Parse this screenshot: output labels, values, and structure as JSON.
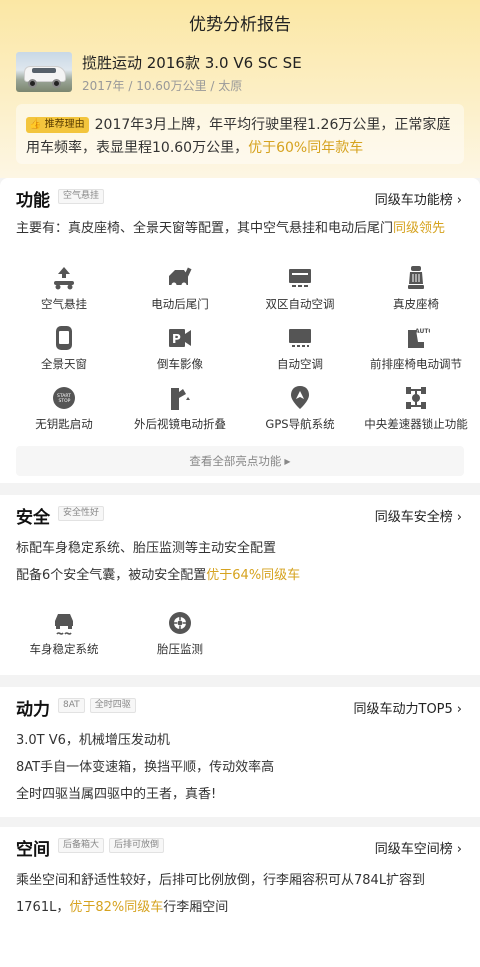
{
  "page": {
    "title": "优势分析报告"
  },
  "car": {
    "name": "揽胜运动 2016款 3.0 V6 SC SE",
    "meta": "2017年 / 10.60万公里 / 太原"
  },
  "reason": {
    "tag": "推荐理由",
    "text": "2017年3月上牌，年平均行驶里程1.26万公里，正常家庭用车频率，表显里程10.60万公里，",
    "highlight": "优于60%同年款车"
  },
  "function": {
    "title": "功能",
    "tags": [
      "空气悬挂"
    ],
    "link": "同级车功能榜",
    "desc_prefix": "主要有：真皮座椅、全景天窗等配置，其中空气悬挂和电动后尾门",
    "desc_highlight": "同级领先",
    "features": [
      {
        "label": "空气悬挂",
        "icon": "air-suspension-icon"
      },
      {
        "label": "电动后尾门",
        "icon": "power-tailgate-icon"
      },
      {
        "label": "双区自动空调",
        "icon": "dual-zone-ac-icon"
      },
      {
        "label": "真皮座椅",
        "icon": "leather-seat-icon"
      },
      {
        "label": "全景天窗",
        "icon": "panoramic-sunroof-icon"
      },
      {
        "label": "倒车影像",
        "icon": "reverse-camera-icon"
      },
      {
        "label": "自动空调",
        "icon": "auto-ac-icon"
      },
      {
        "label": "前排座椅电动调节",
        "icon": "power-seat-icon"
      },
      {
        "label": "无钥匙启动",
        "icon": "keyless-start-icon"
      },
      {
        "label": "外后视镜电动折叠",
        "icon": "mirror-fold-icon"
      },
      {
        "label": "GPS导航系统",
        "icon": "gps-icon"
      },
      {
        "label": "中央差速器锁止功能",
        "icon": "diff-lock-icon"
      }
    ],
    "view_all": "查看全部亮点功能"
  },
  "safety": {
    "title": "安全",
    "tags": [
      "安全性好"
    ],
    "link": "同级车安全榜",
    "line1": "标配车身稳定系统、胎压监测等主动安全配置",
    "line2_prefix": "配备6个安全气囊，被动安全配置",
    "line2_highlight": "优于64%同级车",
    "features": [
      {
        "label": "车身稳定系统",
        "icon": "esp-icon"
      },
      {
        "label": "胎压监测",
        "icon": "tire-pressure-icon"
      }
    ]
  },
  "power": {
    "title": "动力",
    "tags": [
      "8AT",
      "全时四驱"
    ],
    "link": "同级车动力TOP5",
    "lines": [
      "3.0T V6，机械增压发动机",
      "8AT手自一体变速箱，换挡平顺，传动效率高",
      "全时四驱当属四驱中的王者，真香!"
    ]
  },
  "space": {
    "title": "空间",
    "tags": [
      "后备箱大",
      "后排可放倒"
    ],
    "link": "同级车空间榜",
    "line1": "乘坐空间和舒适性较好，后排可比例放倒，行李厢容积可从784L扩容到",
    "line2_prefix": "1761L，",
    "line2_highlight": "优于82%同级车",
    "line2_suffix": "行李厢空间"
  },
  "colors": {
    "accent_gold": "#d6a320",
    "tag_yellow": "#f3c53d",
    "icon_gray": "#555555"
  }
}
